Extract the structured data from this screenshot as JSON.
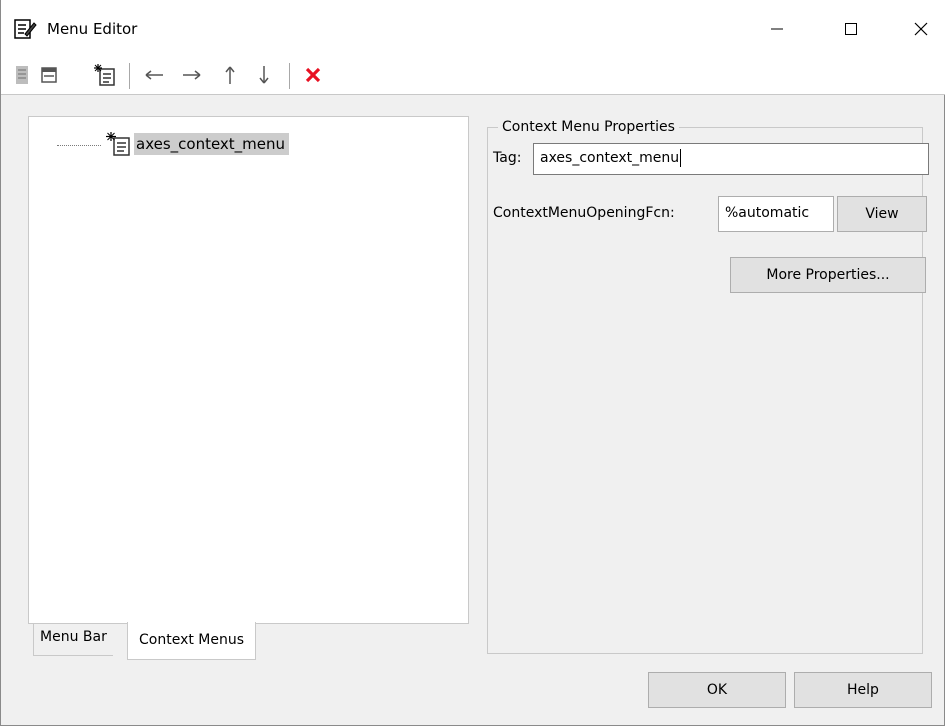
{
  "window": {
    "title": "Menu Editor",
    "icons": {
      "app": "menu-editor-icon",
      "minimize": "minimize-icon",
      "maximize": "maximize-icon",
      "close": "close-icon"
    }
  },
  "toolbar": {
    "buttons": [
      {
        "name": "new-menu",
        "icon": "new-menu-icon"
      },
      {
        "name": "new-menu-item",
        "icon": "new-menu-item-icon"
      },
      {
        "name": "new-context-menu",
        "icon": "new-context-menu-icon"
      },
      {
        "name": "move-left",
        "icon": "arrow-left-icon"
      },
      {
        "name": "move-right",
        "icon": "arrow-right-icon"
      },
      {
        "name": "move-up",
        "icon": "arrow-up-icon"
      },
      {
        "name": "move-down",
        "icon": "arrow-down-icon"
      },
      {
        "name": "delete",
        "icon": "delete-icon"
      }
    ]
  },
  "tree": {
    "items": [
      {
        "label": "axes_context_menu",
        "icon": "context-menu-icon",
        "selected": true
      }
    ]
  },
  "tabs": [
    {
      "label": "Menu Bar",
      "active": false
    },
    {
      "label": "Context Menus",
      "active": true
    }
  ],
  "properties": {
    "group_title": "Context Menu Properties",
    "tag_label": "Tag:",
    "tag_value": "axes_context_menu",
    "fcn_label": "ContextMenuOpeningFcn:",
    "fcn_value": "%automatic",
    "view_button": "View",
    "more_button": "More Properties..."
  },
  "footer": {
    "ok_button": "OK",
    "help_button": "Help"
  },
  "colors": {
    "delete_accent": "#e81123",
    "selection_bg": "#cccccc"
  }
}
